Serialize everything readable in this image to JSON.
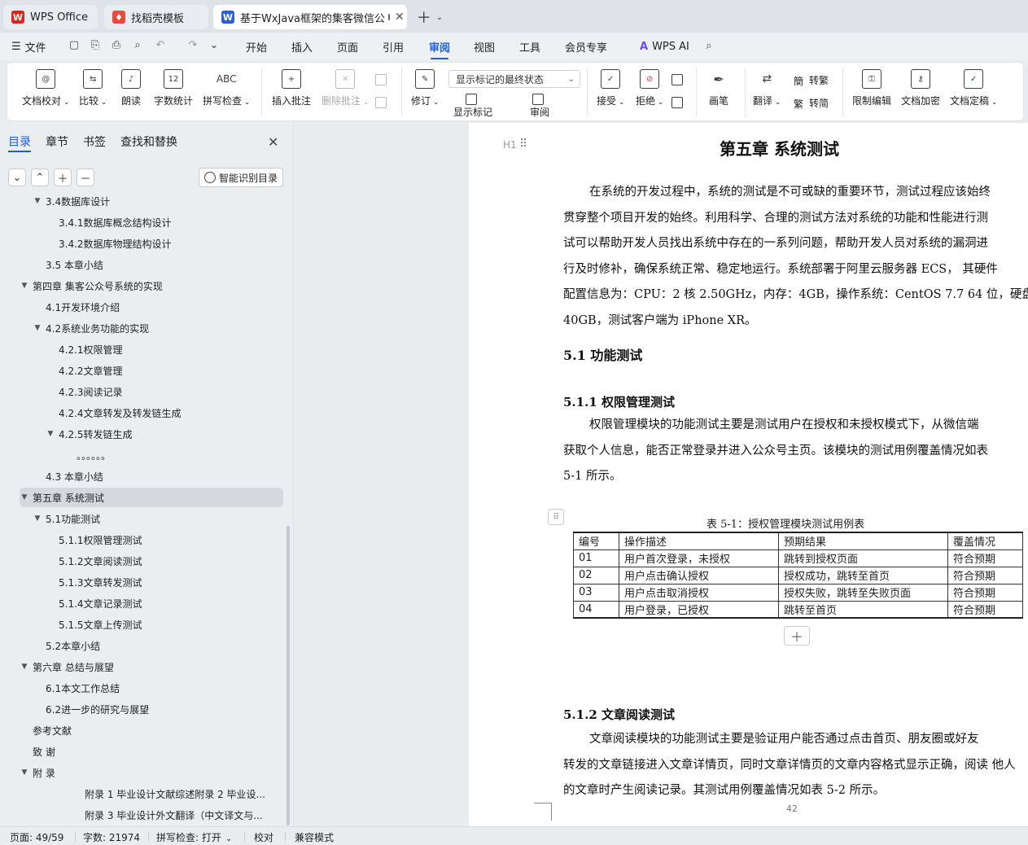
{
  "tabs": [
    {
      "label": "WPS Office",
      "logo": "W",
      "color": "#e2231a"
    },
    {
      "label": "找稻壳模板",
      "logo": "♦",
      "color": "#e94a3c"
    },
    {
      "label": "基于WxJava框架的集客微信公",
      "logo": "W",
      "color": "#2b5fd9"
    }
  ],
  "menu": {
    "file": "文件",
    "items": [
      "开始",
      "插入",
      "页面",
      "引用",
      "审阅",
      "视图",
      "工具",
      "会员专享"
    ],
    "active": "审阅",
    "wps_ai": "WPS AI"
  },
  "ribbon": {
    "doc_check": "文档校对",
    "compare": "比较",
    "read_aloud": "朗读",
    "word_count": "字数统计",
    "spell_check": "拼写检查",
    "insert_comment": "插入批注",
    "delete_comment": "删除批注",
    "revise": "修订",
    "display_select": "显示标记的最终状态",
    "show_markup": "显示标记",
    "review": "审阅",
    "accept": "接受",
    "reject": "拒绝",
    "pen": "画笔",
    "translate": "翻译",
    "to_traditional": "转繁",
    "to_simplified": "转简",
    "restrict_edit": "限制编辑",
    "encrypt": "文档加密",
    "finalize": "文档定稿",
    "icon_text": {
      "word_count": "12",
      "spell_check": "ABC"
    }
  },
  "sidebar": {
    "tabs": [
      "目录",
      "章节",
      "书签",
      "查找和替换"
    ],
    "smart_button": "智能识别目录",
    "toc": [
      {
        "label": "3.4数据库设计",
        "level": 2,
        "arrow": "▼"
      },
      {
        "label": "3.4.1数据库概念结构设计",
        "level": 3,
        "arrow": ""
      },
      {
        "label": "3.4.2数据库物理结构设计",
        "level": 3,
        "arrow": ""
      },
      {
        "label": "3.5 本章小结",
        "level": 2,
        "arrow": ""
      },
      {
        "label": "第四章 集客公众号系统的实现",
        "level": 1,
        "arrow": "▼"
      },
      {
        "label": "4.1开发环境介绍",
        "level": 2,
        "arrow": ""
      },
      {
        "label": "4.2系统业务功能的实现",
        "level": 2,
        "arrow": "▼"
      },
      {
        "label": "4.2.1权限管理",
        "level": 3,
        "arrow": ""
      },
      {
        "label": "4.2.2文章管理",
        "level": 3,
        "arrow": ""
      },
      {
        "label": "4.2.3阅读记录",
        "level": 3,
        "arrow": ""
      },
      {
        "label": "4.2.4文章转发及转发链生成",
        "level": 3,
        "arrow": ""
      },
      {
        "label": "4.2.5转发链生成",
        "level": 3,
        "arrow": "▼"
      },
      {
        "label": "。。。。。。",
        "level": 4,
        "arrow": ""
      },
      {
        "label": "4.3 本章小结",
        "level": 2,
        "arrow": ""
      },
      {
        "label": "第五章 系统测试",
        "level": 1,
        "arrow": "▼",
        "active": true
      },
      {
        "label": "5.1功能测试",
        "level": 2,
        "arrow": "▼"
      },
      {
        "label": "5.1.1权限管理测试",
        "level": 3,
        "arrow": ""
      },
      {
        "label": "5.1.2文章阅读测试",
        "level": 3,
        "arrow": ""
      },
      {
        "label": "5.1.3文章转发测试",
        "level": 3,
        "arrow": ""
      },
      {
        "label": "5.1.4文章记录测试",
        "level": 3,
        "arrow": ""
      },
      {
        "label": "5.1.5文章上传测试",
        "level": 3,
        "arrow": ""
      },
      {
        "label": "5.2本章小结",
        "level": 2,
        "arrow": ""
      },
      {
        "label": "第六章 总结与展望",
        "level": 1,
        "arrow": "▼"
      },
      {
        "label": "6.1本文工作总结",
        "level": 2,
        "arrow": ""
      },
      {
        "label": "6.2进一步的研究与展望",
        "level": 2,
        "arrow": ""
      },
      {
        "label": "参考文献",
        "level": 1,
        "arrow": ""
      },
      {
        "label": "致 谢",
        "level": 1,
        "arrow": ""
      },
      {
        "label": "附 录",
        "level": 1,
        "arrow": "▼"
      },
      {
        "label": "附录 1 毕业设计文献综述附录 2 毕业设...",
        "level": 5,
        "arrow": ""
      },
      {
        "label": "附录 3 毕业设计外文翻译（中文译文与...",
        "level": 5,
        "arrow": ""
      }
    ]
  },
  "document": {
    "heading_marker": "H1",
    "chapter_title": "第五章  系统测试",
    "intro_lines": [
      "在系统的开发过程中，系统的测试是不可或缺的重要环节，测试过程应该始终",
      "贯穿整个项目开发的始终。利用科学、合理的测试方法对系统的功能和性能进行测",
      "试可以帮助开发人员找出系统中存在的一系列问题，帮助开发人员对系统的漏洞进",
      "行及时修补，确保系统正常、稳定地运行。系统部署于阿里云服务器 ECS，  其硬件",
      "配置信息为：CPU：2 核 2.50GHz，内存：4GB，操作系统：CentOS 7.7 64 位，硬盘",
      "40GB，测试客户端为 iPhone XR。"
    ],
    "section_5_1": "5.1    功能测试",
    "section_5_1_1": "5.1.1    权限管理测试",
    "p511_lines": [
      "权限管理模块的功能测试主要是测试用户在授权和未授权模式下，从微信端",
      "获取个人信息，能否正常登录并进入公众号主页。该模块的测试用例覆盖情况如表",
      "5-1 所示。"
    ],
    "table_caption": "表  5-1：授权管理模块测试用例表",
    "table": {
      "headers": [
        "编号",
        "操作描述",
        "预期结果",
        "覆盖情况"
      ],
      "rows": [
        [
          "01",
          "用户首次登录，未授权",
          "跳转到授权页面",
          "符合预期"
        ],
        [
          "02",
          "用户点击确认授权",
          "授权成功，跳转至首页",
          "符合预期"
        ],
        [
          "03",
          "用户点击取消授权",
          "授权失败，跳转至失败页面",
          "符合预期"
        ],
        [
          "04",
          "用户登录，已授权",
          "跳转至首页",
          "符合预期"
        ]
      ]
    },
    "section_5_1_2": "5.1.2    文章阅读测试",
    "p512_lines": [
      "文章阅读模块的功能测试主要是验证用户能否通过点击首页、朋友圈或好友",
      "转发的文章链接进入文章详情页，同时文章详情页的文章内容格式显示正确，阅读   他人",
      "的文章时产生阅读记录。其测试用例覆盖情况如表 5-2 所示。"
    ],
    "page_number": "42"
  },
  "status": {
    "page": "页面: 49/59",
    "words": "字数: 21974",
    "spell": "拼写检查: 打开",
    "proofread": "校对",
    "compat": "兼容模式"
  }
}
